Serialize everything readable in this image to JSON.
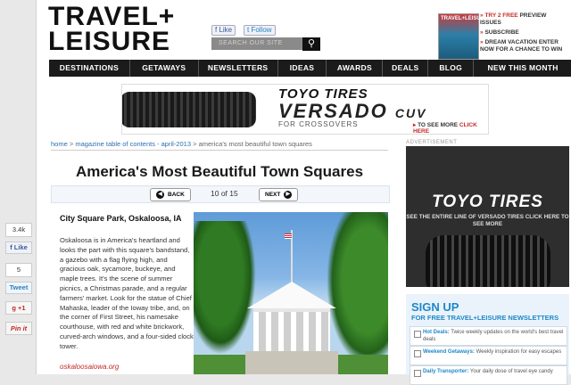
{
  "header": {
    "logo_line1": "TRAVEL+",
    "logo_line2": "LEISURE",
    "like_label": "Like",
    "follow_label": "Follow",
    "search_placeholder": "SEARCH OUR SITE",
    "magazine_title": "TRAVEL+LEISURE",
    "promo": [
      {
        "marker": "»",
        "text_red": "TRY 2 FREE",
        "text": "PREVIEW ISSUES"
      },
      {
        "marker": "»",
        "text_red": "",
        "text": "SUBSCRIBE"
      },
      {
        "marker": "»",
        "text_red": "",
        "text": "DREAM VACATION ENTER NOW FOR A CHANCE TO WIN"
      }
    ]
  },
  "nav": {
    "items": [
      "DESTINATIONS",
      "GETAWAYS",
      "NEWSLETTERS",
      "IDEAS",
      "AWARDS",
      "DEALS",
      "BLOG",
      "NEW THIS MONTH"
    ]
  },
  "top_ad": {
    "brand": "TOYO TIRES",
    "model": "VERSADO",
    "model_suffix": "CUV",
    "subline": "FOR CROSSOVERS",
    "cta_prefix": "TO SEE MORE",
    "cta_link": "CLICK HERE"
  },
  "breadcrumb": {
    "home": "home",
    "sep": " > ",
    "issue": "magazine table of contents - april-2013",
    "current": "america's most beautiful town squares"
  },
  "article": {
    "title": "America's Most Beautiful Town Squares",
    "back_label": "BACK",
    "next_label": "NEXT",
    "page_counter": "10 of 15",
    "spot_title": "City Square Park, Oskaloosa, IA",
    "body": "Oskaloosa is in America's heartland and looks the part with this square's bandstand, a gazebo with a flag flying high, and gracious oak, sycamore, buckeye, and maple trees. It's the scene of summer picnics, a Christmas parade, and a regular farmers' market. Look for the statue of Chief Mahaska, leader of the Ioway tribe, and, on the corner of First Street, his namesake courthouse, with red and white brickwork, curved-arch windows, and a four-sided clock tower.",
    "link": "oskaloosaiowa.org"
  },
  "social": {
    "fb_count": "3.4k",
    "fb_label": "Like",
    "tw_count": "5",
    "tw_label": "Tweet",
    "gp_label": "+1",
    "pin_label": "Pin it"
  },
  "sidebar": {
    "ad_label": "ADVERTISEMENT",
    "ad_brand": "TOYO TIRES",
    "ad_sub": "SEE THE ENTIRE LINE OF VERSADO TIRES CLICK HERE TO SEE MORE",
    "signup_title": "SIGN UP",
    "signup_sub": "FOR FREE TRAVEL+LEISURE NEWSLETTERS",
    "newsletters": [
      {
        "name": "Hot Deals:",
        "desc": "Twice weekly updates on the world's best travel deals"
      },
      {
        "name": "Weekend Getaways:",
        "desc": "Weekly inspiration for easy escapes"
      },
      {
        "name": "Daily Transporter:",
        "desc": "Your daily dose of travel eye candy"
      }
    ]
  }
}
